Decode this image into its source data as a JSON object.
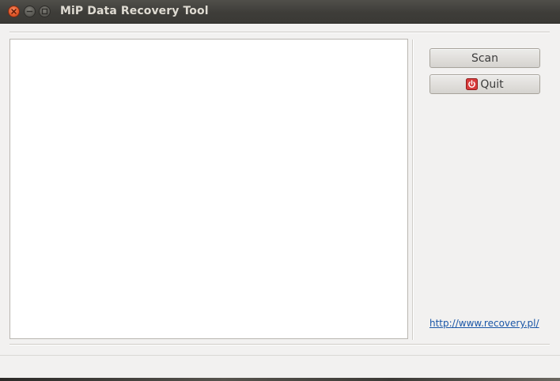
{
  "window": {
    "title": "MiP Data Recovery Tool"
  },
  "window_controls": {
    "close_icon": "close-icon",
    "minimize_icon": "minimize-icon",
    "maximize_icon": "maximize-icon"
  },
  "output_area": {
    "content": ""
  },
  "buttons": {
    "scan_label": "Scan",
    "quit_label": "Quit",
    "quit_icon": "power-icon"
  },
  "link": {
    "text": "http://www.recovery.pl/"
  },
  "colors": {
    "titlebar": "#3e3d39",
    "close_button": "#e25a2b",
    "link": "#1a56a7",
    "quit_icon": "#d83a3a"
  }
}
